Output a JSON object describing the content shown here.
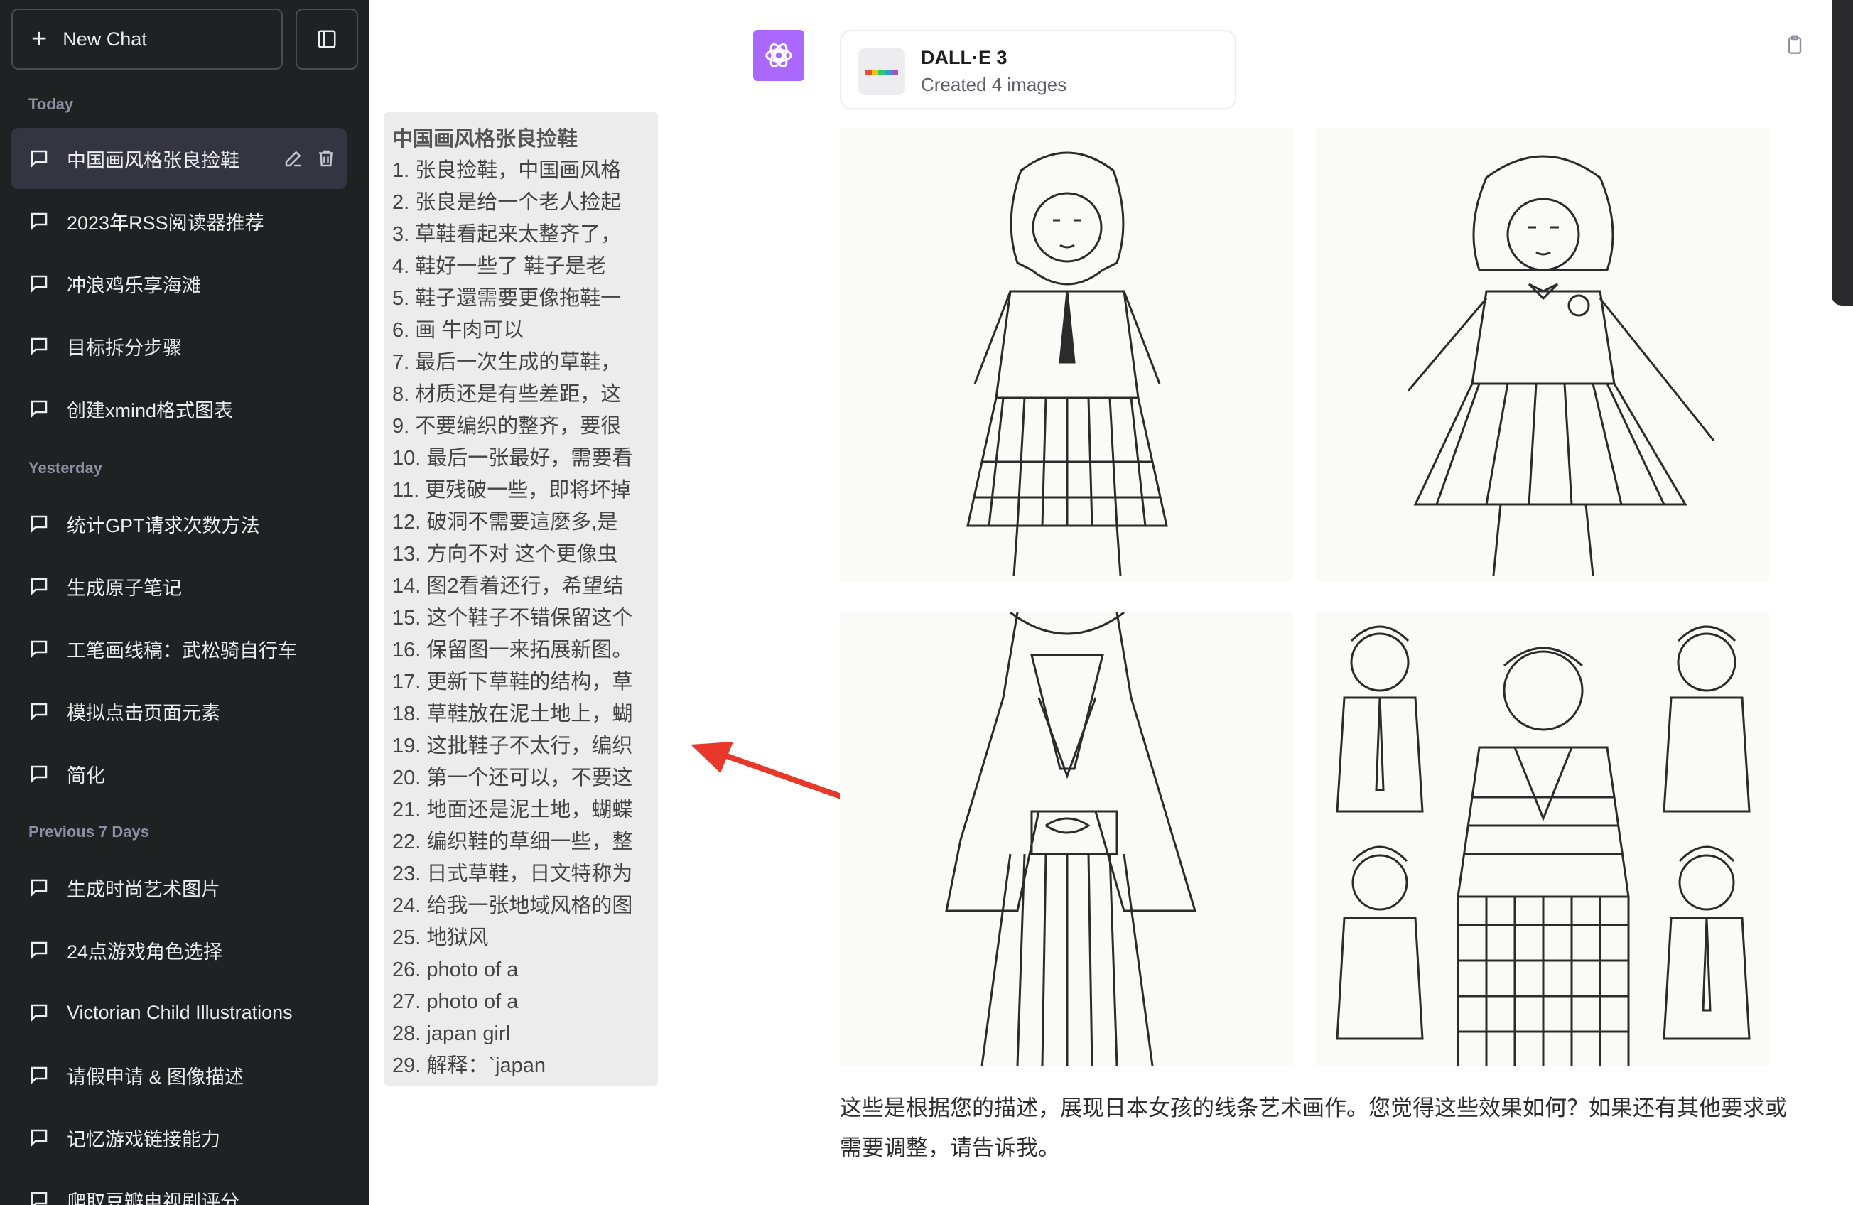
{
  "sidebar": {
    "new_chat": "New Chat",
    "sections": [
      {
        "label": "Today",
        "items": [
          "中国画风格张良捡鞋",
          "2023年RSS阅读器推荐",
          "冲浪鸡乐享海滩",
          "目标拆分步骤",
          "创建xmind格式图表"
        ]
      },
      {
        "label": "Yesterday",
        "items": [
          "统计GPT请求次数方法",
          "生成原子笔记",
          "工笔画线稿：武松骑自行车",
          "模拟点击页面元素",
          "简化"
        ]
      },
      {
        "label": "Previous 7 Days",
        "items": [
          "生成时尚艺术图片",
          "24点游戏角色选择",
          "Victorian Child Illustrations",
          "请假申请 & 图像描述",
          "记忆游戏链接能力",
          "爬取豆瓣电视剧评分"
        ]
      }
    ]
  },
  "prompt_list": {
    "title": "中国画风格张良捡鞋",
    "lines": [
      "1. 张良捡鞋，中国画风格",
      "2. 张良是给一个老人捡起",
      "3. 草鞋看起来太整齐了，",
      "4. 鞋好一些了 鞋子是老",
      "5. 鞋子還需要更像拖鞋一",
      "6. 画 牛肉可以",
      "7. 最后一次生成的草鞋，",
      "8. 材质还是有些差距，这",
      "9. 不要编织的整齐，要很",
      "10. 最后一张最好，需要看",
      "11. 更残破一些，即将坏掉",
      "12. 破洞不需要這麼多,是",
      "13. 方向不对 这个更像虫",
      "14. 图2看着还行，希望结",
      "15. 这个鞋子不错保留这个",
      "16. 保留图一来拓展新图。",
      "17. 更新下草鞋的结构，草",
      "18. 草鞋放在泥土地上，蝴",
      "19. 这批鞋子不太行，编织",
      "20. 第一个还可以，不要这",
      "21. 地面还是泥土地，蝴蝶",
      "22. 编织鞋的草细一些，整",
      "23. 日式草鞋，日文特称为",
      "24. 给我一张地域风格的图",
      "25. 地狱风",
      "26. photo of a",
      "27. photo of a",
      "28. japan girl",
      "29. 解释：`japan"
    ]
  },
  "dalle": {
    "name": "DALL·E 3",
    "subtitle": "Created 4 images",
    "stripe_colors": [
      "#e74c3c",
      "#f1c40f",
      "#2ecc71",
      "#3498db",
      "#9b59b6"
    ]
  },
  "response": {
    "text": "这些是根据您的描述，展现日本女孩的线条艺术画作。您觉得这些效果如何？如果还有其他要求或需要调整，请告诉我。"
  },
  "colors": {
    "sidebar_bg": "#202123",
    "active_item_bg": "#343541",
    "avatar_bg": "#ab68ff",
    "arrow": "#e8382a"
  }
}
